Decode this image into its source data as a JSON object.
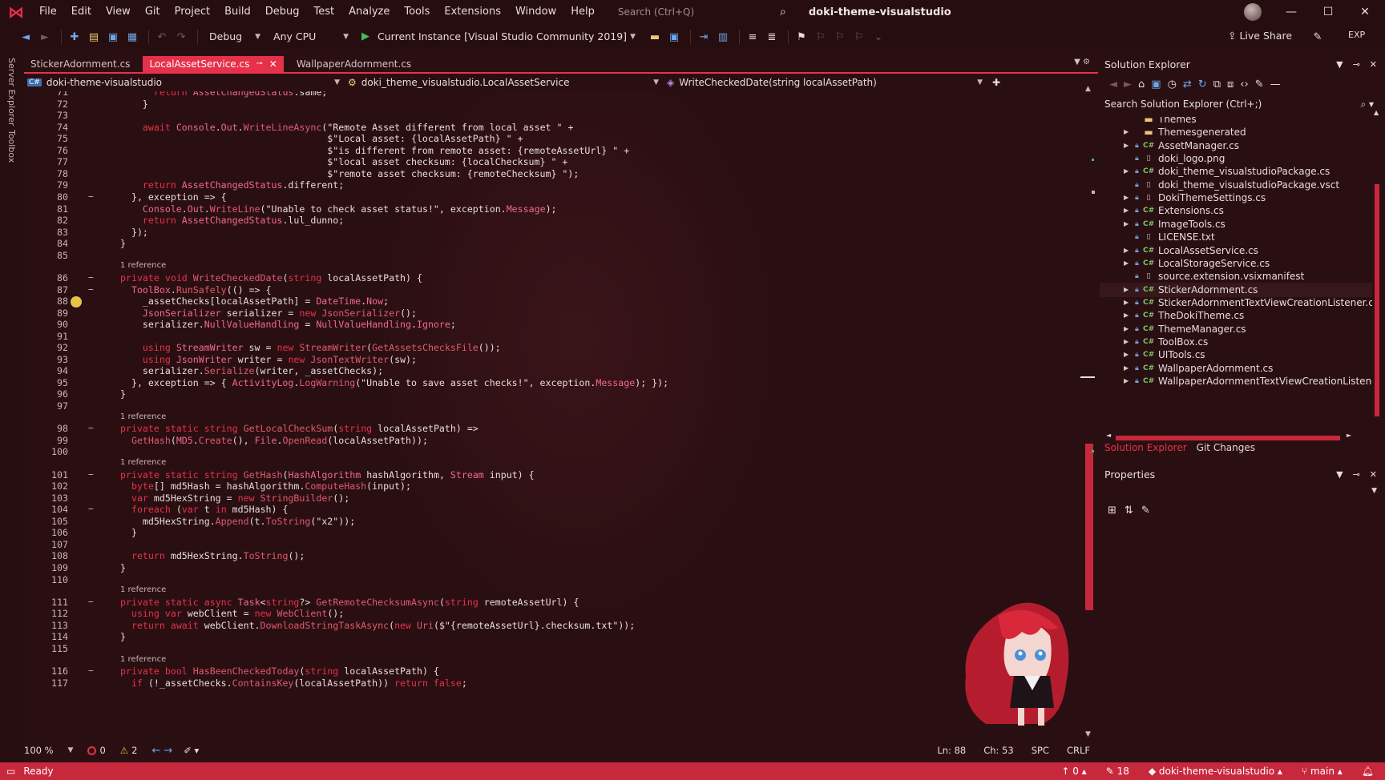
{
  "menubar": {
    "items": [
      "File",
      "Edit",
      "View",
      "Git",
      "Project",
      "Build",
      "Debug",
      "Test",
      "Analyze",
      "Tools",
      "Extensions",
      "Window",
      "Help"
    ],
    "search_placeholder": "Search (Ctrl+Q)",
    "solution_title": "doki-theme-visualstudio"
  },
  "toolbar": {
    "configuration": "Debug",
    "platform": "Any CPU",
    "run_target": "Current Instance [Visual Studio Community 2019]",
    "live_share": "Live Share",
    "exp": "EXP"
  },
  "side_strip": {
    "server_explorer": "Server Explorer",
    "toolbox": "Toolbox"
  },
  "tabs": [
    {
      "label": "StickerAdornment.cs",
      "active": false
    },
    {
      "label": "LocalAssetService.cs",
      "active": true
    },
    {
      "label": "WallpaperAdornment.cs",
      "active": false
    }
  ],
  "navbar": {
    "project": "doki-theme-visualstudio",
    "class": "doki_theme_visualstudio.LocalAssetService",
    "member": "WriteCheckedDate(string localAssetPath)"
  },
  "code": {
    "lines": [
      {
        "n": "71",
        "text": "      return AssetChangedStatus.same;"
      },
      {
        "n": "72",
        "text": "    }"
      },
      {
        "n": "73",
        "text": ""
      },
      {
        "n": "74",
        "text": "    await Console.Out.WriteLineAsync(\"Remote Asset different from local asset \" +"
      },
      {
        "n": "75",
        "text": "                                     $\"Local asset: {localAssetPath} \" +"
      },
      {
        "n": "76",
        "text": "                                     $\"is different from remote asset: {remoteAssetUrl} \" +"
      },
      {
        "n": "77",
        "text": "                                     $\"local asset checksum: {localChecksum} \" +"
      },
      {
        "n": "78",
        "text": "                                     $\"remote asset checksum: {remoteChecksum} \");"
      },
      {
        "n": "79",
        "text": "    return AssetChangedStatus.different;"
      },
      {
        "n": "80",
        "text": "  }, exception => {"
      },
      {
        "n": "81",
        "text": "    Console.Out.WriteLine(\"Unable to check asset status!\", exception.Message);"
      },
      {
        "n": "82",
        "text": "    return AssetChangedStatus.lul_dunno;"
      },
      {
        "n": "83",
        "text": "  });"
      },
      {
        "n": "84",
        "text": "}"
      },
      {
        "n": "85",
        "text": ""
      },
      {
        "ref": "1 reference"
      },
      {
        "n": "86",
        "text": "private void WriteCheckedDate(string localAssetPath) {"
      },
      {
        "n": "87",
        "text": "  ToolBox.RunSafely(() => {"
      },
      {
        "n": "88",
        "text": "    _assetChecks[localAssetPath] = DateTime.Now;"
      },
      {
        "n": "89",
        "text": "    JsonSerializer serializer = new JsonSerializer();"
      },
      {
        "n": "90",
        "text": "    serializer.NullValueHandling = NullValueHandling.Ignore;"
      },
      {
        "n": "91",
        "text": ""
      },
      {
        "n": "92",
        "text": "    using StreamWriter sw = new StreamWriter(GetAssetsChecksFile());"
      },
      {
        "n": "93",
        "text": "    using JsonWriter writer = new JsonTextWriter(sw);"
      },
      {
        "n": "94",
        "text": "    serializer.Serialize(writer, _assetChecks);"
      },
      {
        "n": "95",
        "text": "  }, exception => { ActivityLog.LogWarning(\"Unable to save asset checks!\", exception.Message); });"
      },
      {
        "n": "96",
        "text": "}"
      },
      {
        "n": "97",
        "text": ""
      },
      {
        "ref": "1 reference"
      },
      {
        "n": "98",
        "text": "private static string GetLocalCheckSum(string localAssetPath) =>"
      },
      {
        "n": "99",
        "text": "  GetHash(MD5.Create(), File.OpenRead(localAssetPath));"
      },
      {
        "n": "100",
        "text": ""
      },
      {
        "ref": "1 reference"
      },
      {
        "n": "101",
        "text": "private static string GetHash(HashAlgorithm hashAlgorithm, Stream input) {"
      },
      {
        "n": "102",
        "text": "  byte[] md5Hash = hashAlgorithm.ComputeHash(input);"
      },
      {
        "n": "103",
        "text": "  var md5HexString = new StringBuilder();"
      },
      {
        "n": "104",
        "text": "  foreach (var t in md5Hash) {"
      },
      {
        "n": "105",
        "text": "    md5HexString.Append(t.ToString(\"x2\"));"
      },
      {
        "n": "106",
        "text": "  }"
      },
      {
        "n": "107",
        "text": ""
      },
      {
        "n": "108",
        "text": "  return md5HexString.ToString();"
      },
      {
        "n": "109",
        "text": "}"
      },
      {
        "n": "110",
        "text": ""
      },
      {
        "ref": "1 reference"
      },
      {
        "n": "111",
        "text": "private static async Task<string?> GetRemoteChecksumAsync(string remoteAssetUrl) {"
      },
      {
        "n": "112",
        "text": "  using var webClient = new WebClient();"
      },
      {
        "n": "113",
        "text": "  return await webClient.DownloadStringTaskAsync(new Uri($\"{remoteAssetUrl}.checksum.txt\"));"
      },
      {
        "n": "114",
        "text": "}"
      },
      {
        "n": "115",
        "text": ""
      },
      {
        "ref": "1 reference"
      },
      {
        "n": "116",
        "text": "private bool HasBeenCheckedToday(string localAssetPath) {"
      },
      {
        "n": "117",
        "text": "  if (!_assetChecks.ContainsKey(localAssetPath)) return false;"
      }
    ]
  },
  "editor_footer": {
    "zoom": "100 %",
    "errors": "0",
    "warnings": "2",
    "ln": "Ln: 88",
    "ch": "Ch: 53",
    "spc": "SPC",
    "eol": "CRLF"
  },
  "solution_explorer": {
    "title": "Solution Explorer",
    "search_placeholder": "Search Solution Explorer (Ctrl+;)",
    "nodes": [
      {
        "label": "Themes",
        "icon": "folder",
        "expandable": false
      },
      {
        "label": "Themesgenerated",
        "icon": "folder",
        "expandable": true
      },
      {
        "label": "AssetManager.cs",
        "icon": "cs",
        "expandable": true
      },
      {
        "label": "doki_logo.png",
        "icon": "file",
        "expandable": false
      },
      {
        "label": "doki_theme_visualstudioPackage.cs",
        "icon": "cs",
        "expandable": true
      },
      {
        "label": "doki_theme_visualstudioPackage.vsct",
        "icon": "file",
        "expandable": false
      },
      {
        "label": "DokiThemeSettings.cs",
        "icon": "file",
        "expandable": true
      },
      {
        "label": "Extensions.cs",
        "icon": "cs",
        "expandable": true
      },
      {
        "label": "ImageTools.cs",
        "icon": "cs",
        "expandable": true
      },
      {
        "label": "LICENSE.txt",
        "icon": "file",
        "expandable": false
      },
      {
        "label": "LocalAssetService.cs",
        "icon": "cs",
        "expandable": true
      },
      {
        "label": "LocalStorageService.cs",
        "icon": "cs",
        "expandable": true
      },
      {
        "label": "source.extension.vsixmanifest",
        "icon": "file",
        "expandable": false
      },
      {
        "label": "StickerAdornment.cs",
        "icon": "cs",
        "expandable": true
      },
      {
        "label": "StickerAdornmentTextViewCreationListener.cs",
        "icon": "cs",
        "expandable": true
      },
      {
        "label": "TheDokiTheme.cs",
        "icon": "cs",
        "expandable": true
      },
      {
        "label": "ThemeManager.cs",
        "icon": "cs",
        "expandable": true
      },
      {
        "label": "ToolBox.cs",
        "icon": "cs",
        "expandable": true
      },
      {
        "label": "UITools.cs",
        "icon": "cs",
        "expandable": true
      },
      {
        "label": "WallpaperAdornment.cs",
        "icon": "cs",
        "expandable": true
      },
      {
        "label": "WallpaperAdornmentTextViewCreationListener.cs",
        "icon": "cs",
        "expandable": true
      }
    ],
    "bottom_tabs": [
      "Solution Explorer",
      "Git Changes"
    ]
  },
  "properties": {
    "title": "Properties"
  },
  "statusbar": {
    "ready": "Ready",
    "up_count": "0",
    "pencil_count": "18",
    "repo": "doki-theme-visualstudio",
    "branch": "main"
  },
  "colors": {
    "accent": "#e6314a",
    "background": "#2a0f12",
    "status": "#c8283c"
  }
}
